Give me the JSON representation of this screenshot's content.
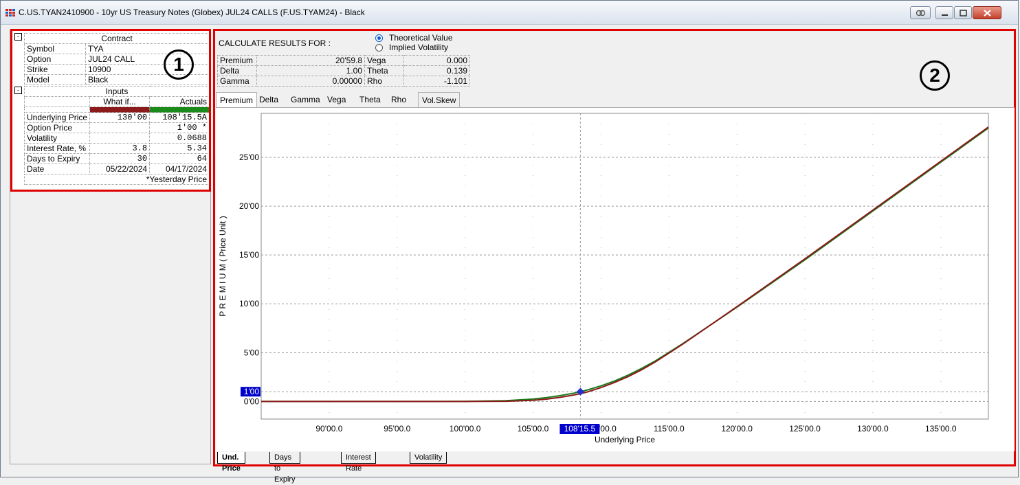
{
  "window": {
    "title": "C.US.TYAN2410900 - 10yr US Treasury Notes (Globex) JUL24 CALLS (F.US.TYAM24) - Black"
  },
  "annotations": {
    "one": "1",
    "two": "2"
  },
  "contract": {
    "header": "Contract",
    "rows": [
      {
        "label": "Symbol",
        "value": "TYA"
      },
      {
        "label": "Option",
        "value": "JUL24 CALL"
      },
      {
        "label": "Strike",
        "value": "10900"
      },
      {
        "label": "Model",
        "value": "Black"
      }
    ]
  },
  "inputs": {
    "header": "Inputs",
    "col_whatif": "What if...",
    "col_actuals": "Actuals",
    "rows": [
      {
        "label": "Underlying Price",
        "whatif": "130'00",
        "actual": "108'15.5A"
      },
      {
        "label": "Option Price",
        "whatif": "",
        "actual": "1'00 *"
      },
      {
        "label": "Volatility",
        "whatif": "",
        "actual": "0.0688"
      },
      {
        "label": "Interest Rate, %",
        "whatif": "3.8",
        "actual": "5.34"
      },
      {
        "label": "Days to Expiry",
        "whatif": "30",
        "actual": "64"
      },
      {
        "label": "Date",
        "whatif": "05/22/2024",
        "actual": "04/17/2024"
      }
    ],
    "footnote": "*Yesterday Price"
  },
  "calc": {
    "label": "CALCULATE RESULTS FOR :",
    "option_theoretical": "Theoretical Value",
    "option_implied": "Implied Volatility",
    "selected": "Theoretical Value"
  },
  "results": [
    {
      "l1": "Premium",
      "v1": "20'59.8",
      "l2": "Vega",
      "v2": "0.000"
    },
    {
      "l1": "Delta",
      "v1": "1.00",
      "l2": "Theta",
      "v2": "0.139"
    },
    {
      "l1": "Gamma",
      "v1": "0.00000",
      "l2": "Rho",
      "v2": "-1.101"
    }
  ],
  "tabs": [
    "Premium",
    "Delta",
    "Gamma",
    "Vega",
    "Theta",
    "Rho",
    "Vol.Skew"
  ],
  "active_tab": "Premium",
  "bottom_tabs": [
    "Und. Price",
    "Days to Expiry",
    "Interest Rate",
    "Volatility"
  ],
  "active_bottom_tab": "Und. Price",
  "chart_data": {
    "type": "line",
    "xlabel": "Underlying Price",
    "ylabel": "P R E M I U M ( Price Unit )",
    "x_ticks": [
      "90'00.0",
      "95'00.0",
      "100'00.0",
      "105'00.0",
      "110'00.0",
      "115'00.0",
      "120'00.0",
      "125'00.0",
      "130'00.0",
      "135'00.0"
    ],
    "x_tick_values": [
      90,
      95,
      100,
      105,
      110,
      115,
      120,
      125,
      130,
      135
    ],
    "y_ticks": [
      "0'00",
      "5'00",
      "10'00",
      "15'00",
      "20'00",
      "25'00"
    ],
    "y_tick_values": [
      0,
      5,
      10,
      15,
      20,
      25
    ],
    "xlim": [
      85,
      138.5
    ],
    "ylim": [
      -1.8,
      29.5
    ],
    "x_marker_label": "108'15.5",
    "x_marker_value": 108.484,
    "y_marker_label": "1'00",
    "y_marker_value": 1.0,
    "point": {
      "x": 108.484,
      "y": 1.0
    },
    "series": [
      {
        "color": "#1a7a1a",
        "x": [
          85,
          95,
          100,
          103,
          105,
          106,
          107,
          108,
          108.5,
          109,
          110,
          111,
          112,
          113,
          114,
          116,
          120,
          125,
          130,
          135,
          138.5
        ],
        "y": [
          0,
          0,
          0.01,
          0.08,
          0.25,
          0.4,
          0.6,
          0.85,
          1.0,
          1.18,
          1.6,
          2.1,
          2.7,
          3.4,
          4.15,
          5.9,
          9.65,
          14.5,
          19.5,
          24.5,
          28.0
        ]
      },
      {
        "color": "#8b1a1a",
        "x": [
          85,
          95,
          100,
          103,
          105,
          106,
          107,
          108,
          108.5,
          109,
          110,
          111,
          112,
          113,
          114,
          116,
          120,
          125,
          130,
          135,
          138.5
        ],
        "y": [
          0,
          0,
          0,
          0.02,
          0.12,
          0.24,
          0.42,
          0.66,
          0.8,
          0.98,
          1.42,
          1.95,
          2.55,
          3.25,
          4.05,
          5.85,
          9.7,
          14.6,
          19.6,
          24.6,
          28.1
        ]
      }
    ],
    "grid": true
  }
}
